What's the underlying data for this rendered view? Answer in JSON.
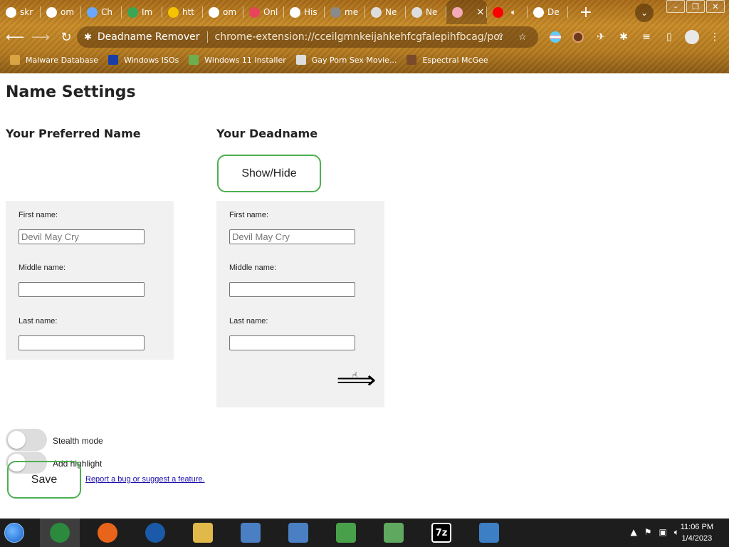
{
  "browser": {
    "tabs": [
      {
        "title": "skr",
        "icon": "feather-icon",
        "color": "#ffffff"
      },
      {
        "title": "om",
        "icon": "google-icon",
        "color": "#ffffff"
      },
      {
        "title": "Ch",
        "icon": "checker-icon",
        "color": "#6aa8ff"
      },
      {
        "title": "Im",
        "icon": "image-icon",
        "color": "#3aa655"
      },
      {
        "title": "htt",
        "icon": "sunglasses-icon",
        "color": "#f5c400"
      },
      {
        "title": "om",
        "icon": "google-icon",
        "color": "#ffffff"
      },
      {
        "title": "Onl",
        "icon": "number-one-icon",
        "color": "#e8445a"
      },
      {
        "title": "His",
        "icon": "history-icon",
        "color": "#ffffff"
      },
      {
        "title": "me",
        "icon": "globe-icon",
        "color": "#8a8a8a"
      },
      {
        "title": "Ne",
        "icon": "chrome-icon",
        "color": "#dddddd"
      },
      {
        "title": "Ne",
        "icon": "chrome-icon",
        "color": "#dddddd"
      },
      {
        "title": "",
        "icon": "trans-flag-icon",
        "color": "#f5a9b8",
        "active": true
      },
      {
        "title": "",
        "icon": "youtube-icon",
        "color": "#ff0000"
      },
      {
        "title": "De",
        "icon": "google-icon",
        "color": "#ffffff"
      }
    ],
    "tab_close": "×",
    "new_tab": "+",
    "window_buttons": [
      "–",
      "❐",
      "✕"
    ],
    "omnibox": {
      "origin": "Deadname Remover",
      "path": "chrome-extension://cceilgmnkeijahkehfcgfalepihfbcag/pop..."
    },
    "bookmarks": [
      {
        "label": "Malware Database",
        "icon": "folder-icon",
        "color": "#d9a441"
      },
      {
        "label": "Windows ISOs",
        "icon": "x-icon",
        "color": "#1a3ea8"
      },
      {
        "label": "Windows 11 Installer",
        "icon": "image-icon",
        "color": "#6fae4f"
      },
      {
        "label": "Gay Porn Sex Movie...",
        "icon": "tux-icon",
        "color": "#dddddd"
      },
      {
        "label": "Espectral McGee",
        "icon": "avatar-icon",
        "color": "#7a4a2a"
      }
    ]
  },
  "page": {
    "title": "Name Settings",
    "preferred_heading": "Your Preferred Name",
    "deadname_heading": "Your Deadname",
    "show_hide_label": "Show/Hide",
    "preferred": {
      "first_label": "First name:",
      "first_placeholder": "Devil May Cry",
      "middle_label": "Middle name:",
      "last_label": "Last name:"
    },
    "deadname": {
      "first_label": "First name:",
      "first_placeholder": "Devil May Cry",
      "middle_label": "Middle name:",
      "last_label": "Last name:"
    },
    "add_arrow": "⟹",
    "stealth_label": "Stealth mode",
    "highlight_label": "Add highlight",
    "save_label": "Save",
    "report_link": "Report a bug or suggest a feature."
  },
  "taskbar": {
    "apps": [
      {
        "name": "chrome",
        "icon": "chrome-icon",
        "color": "#2c8a3e",
        "active": true
      },
      {
        "name": "firefox",
        "icon": "firefox-icon",
        "color": "#e8641b"
      },
      {
        "name": "obama",
        "icon": "obama-logo-icon",
        "color": "#1b5aa8"
      },
      {
        "name": "explorer",
        "icon": "folder-icon",
        "color": "#e0b94a"
      },
      {
        "name": "setup",
        "icon": "setup-icon",
        "color": "#4a7fc4"
      },
      {
        "name": "setup2",
        "icon": "setup-icon",
        "color": "#4a7fc4"
      },
      {
        "name": "network",
        "icon": "network-icon",
        "color": "#49a04a"
      },
      {
        "name": "disk",
        "icon": "disk-icon",
        "color": "#5fa85f"
      },
      {
        "name": "7zip",
        "icon": "7zip-icon",
        "color": "#000000",
        "label": "7z"
      },
      {
        "name": "photos",
        "icon": "photo-icon",
        "color": "#3c7fc4"
      }
    ],
    "tray_up": "▲",
    "time": "11:06 PM",
    "date": "1/4/2023"
  }
}
